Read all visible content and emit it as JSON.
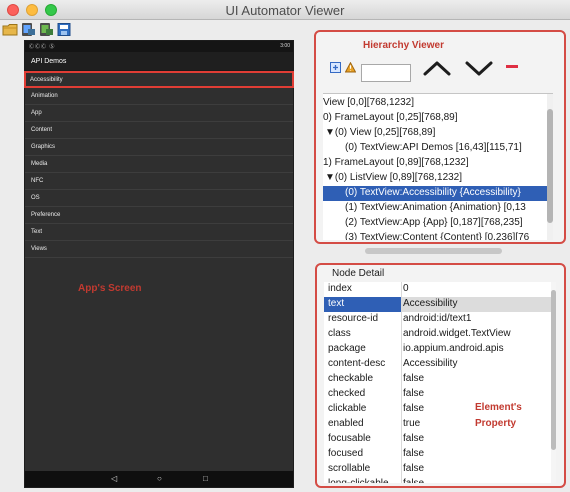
{
  "window": {
    "title": "UI Automator Viewer"
  },
  "toolbar": {
    "buttons": [
      "folder-icon",
      "device-screenshot-icon",
      "device-screenshot-compressed-icon",
      "save-icon"
    ]
  },
  "device": {
    "status_left": "ⒸⒸⒸ Ⓢ",
    "status_right": "3:00",
    "app_title": "API Demos",
    "items": [
      "Accessibility",
      "Animation",
      "App",
      "Content",
      "Graphics",
      "Media",
      "NFC",
      "OS",
      "Preference",
      "Text",
      "Views"
    ],
    "nav": {
      "back": "◁",
      "home": "○",
      "recent": "□"
    }
  },
  "annotations": {
    "app_screen": "App's Screen",
    "hierarchy_viewer": "Hierarchy Viewer",
    "element_line1": "Element's",
    "element_line2": "Property"
  },
  "hierarchy": {
    "rows": [
      {
        "text": "View [0,0][768,1232]",
        "indent": 0,
        "arrow": ""
      },
      {
        "text": "0) FrameLayout [0,25][768,89]",
        "indent": 0,
        "arrow": ""
      },
      {
        "text": "(0) View [0,25][768,89]",
        "indent": 1,
        "arrow": "▼"
      },
      {
        "text": "(0) TextView:API Demos [16,43][115,71]",
        "indent": 2,
        "arrow": ""
      },
      {
        "text": "1) FrameLayout [0,89][768,1232]",
        "indent": 0,
        "arrow": ""
      },
      {
        "text": "(0) ListView [0,89][768,1232]",
        "indent": 1,
        "arrow": "▼"
      },
      {
        "text": "(0) TextView:Accessibility {Accessibility}",
        "indent": 2,
        "arrow": "",
        "selected": true
      },
      {
        "text": "(1) TextView:Animation {Animation} [0,13",
        "indent": 2,
        "arrow": ""
      },
      {
        "text": "(2) TextView:App {App} [0,187][768,235]",
        "indent": 2,
        "arrow": ""
      },
      {
        "text": "(3) TextView:Content {Content} [0,236][76",
        "indent": 2,
        "arrow": ""
      }
    ]
  },
  "node_detail": {
    "title": "Node Detail",
    "rows": [
      {
        "key": "index",
        "value": "0"
      },
      {
        "key": "text",
        "value": "Accessibility",
        "selected": true
      },
      {
        "key": "resource-id",
        "value": "android:id/text1"
      },
      {
        "key": "class",
        "value": "android.widget.TextView"
      },
      {
        "key": "package",
        "value": "io.appium.android.apis"
      },
      {
        "key": "content-desc",
        "value": "Accessibility"
      },
      {
        "key": "checkable",
        "value": "false"
      },
      {
        "key": "checked",
        "value": "false"
      },
      {
        "key": "clickable",
        "value": "false"
      },
      {
        "key": "enabled",
        "value": "true"
      },
      {
        "key": "focusable",
        "value": "false"
      },
      {
        "key": "focused",
        "value": "false"
      },
      {
        "key": "scrollable",
        "value": "false"
      },
      {
        "key": "long-clickable",
        "value": "false"
      }
    ]
  },
  "colors": {
    "annotation_red": "#c23a30",
    "selection_blue": "#2f5fb5"
  }
}
